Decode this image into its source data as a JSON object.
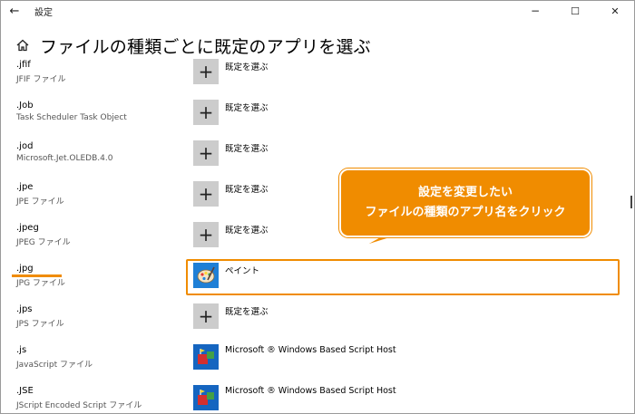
{
  "window": {
    "app_title": "設定",
    "back_glyph": "←",
    "min_glyph": "−",
    "max_glyph": "☐",
    "close_glyph": "✕"
  },
  "header": {
    "title": "ファイルの種類ごとに既定のアプリを選ぶ"
  },
  "plus_glyph": "+",
  "rows": [
    {
      "ext": ".jfif",
      "desc": "JFIF ファイル",
      "app": "既定を選ぶ",
      "icon": "plus-icon"
    },
    {
      "ext": ".Job",
      "desc": "Task Scheduler Task Object",
      "app": "既定を選ぶ",
      "icon": "plus-icon"
    },
    {
      "ext": ".jod",
      "desc": "Microsoft.Jet.OLEDB.4.0",
      "app": "既定を選ぶ",
      "icon": "plus-icon"
    },
    {
      "ext": ".jpe",
      "desc": "JPE ファイル",
      "app": "既定を選ぶ",
      "icon": "plus-icon"
    },
    {
      "ext": ".jpeg",
      "desc": "JPEG ファイル",
      "app": "既定を選ぶ",
      "icon": "plus-icon"
    },
    {
      "ext": ".jpg",
      "desc": "JPG ファイル",
      "app": "ペイント",
      "icon": "paint-icon"
    },
    {
      "ext": ".jps",
      "desc": "JPS ファイル",
      "app": "既定を選ぶ",
      "icon": "plus-icon"
    },
    {
      "ext": ".js",
      "desc": "JavaScript ファイル",
      "app": "Microsoft ® Windows Based Script Host",
      "icon": "script-host-icon"
    },
    {
      "ext": ".JSE",
      "desc": "JScript Encoded Script ファイル",
      "app": "Microsoft ® Windows Based Script Host",
      "icon": "script-host-icon"
    }
  ],
  "callout": {
    "line1": "設定を変更したい",
    "line2": "ファイルの種類のアプリ名をクリック"
  },
  "colors": {
    "accent": "#f08c00"
  }
}
